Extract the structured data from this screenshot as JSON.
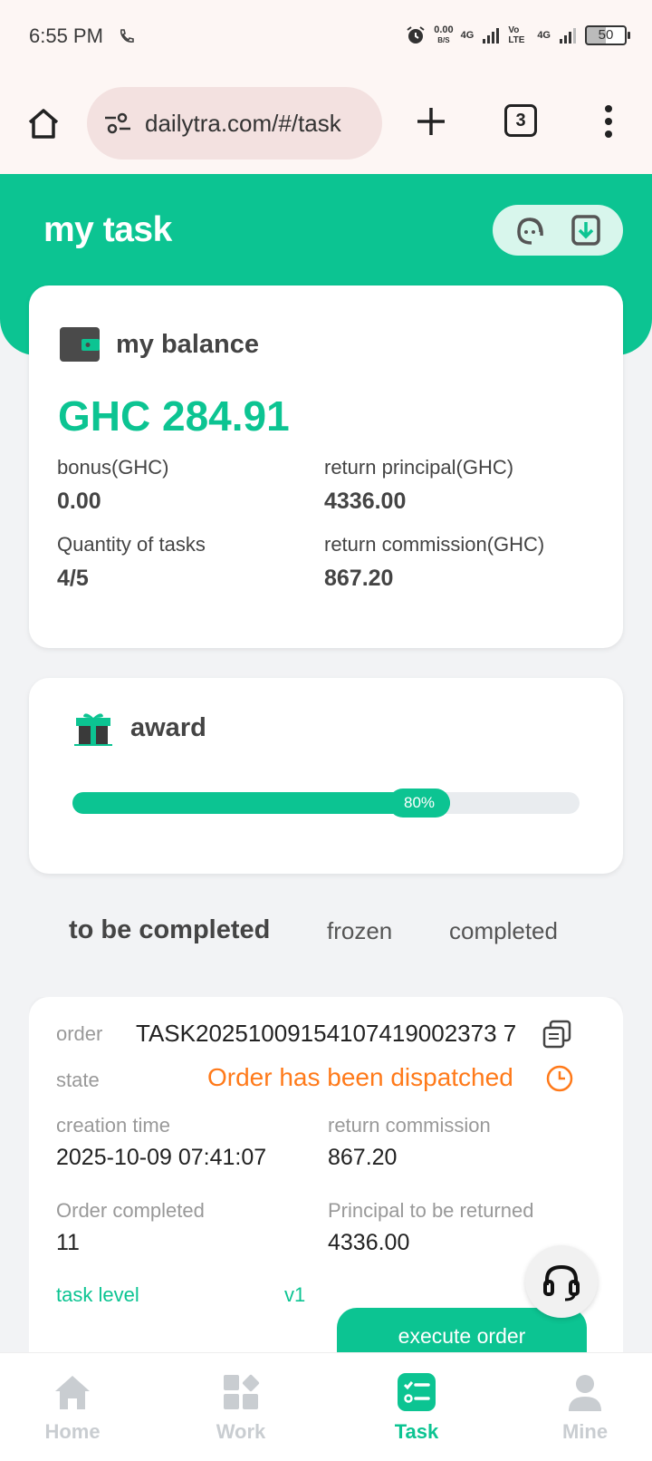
{
  "status_bar": {
    "time": "6:55 PM",
    "speed_value": "0.00",
    "speed_unit": "B/S",
    "net1": "4G",
    "net2": "Vo LTE",
    "net3": "4G",
    "battery": "50"
  },
  "browser": {
    "url": "dailytra.com/#/task",
    "tab_count": "3"
  },
  "header": {
    "title": "my task"
  },
  "balance": {
    "title": "my balance",
    "amount": "GHC 284.91",
    "bonus_label": "bonus(GHC)",
    "bonus_value": "0.00",
    "return_principal_label": "return principal(GHC)",
    "return_principal_value": "4336.00",
    "quantity_label": "Quantity of tasks",
    "quantity_value": "4/5",
    "return_commission_label": "return commission(GHC)",
    "return_commission_value": "867.20"
  },
  "award": {
    "title": "award",
    "progress_label": "80%",
    "progress_fraction": 0.8
  },
  "tabs": [
    "to be completed",
    "frozen",
    "completed"
  ],
  "order": {
    "order_label": "order",
    "order_value": "TASK20251009154107419002373 7",
    "state_label": "state",
    "state_value": "Order has been dispatched",
    "creation_time_label": "creation time",
    "creation_time_value": "2025-10-09 07:41:07",
    "return_commission_label": "return commission",
    "return_commission_value": "867.20",
    "order_completed_label": "Order completed",
    "order_completed_value": "11",
    "principal_label": "Principal to be returned",
    "principal_value": "4336.00",
    "task_level_label": "task level",
    "task_level_value": "v1",
    "execute_button": "execute order"
  },
  "nav": [
    {
      "label": "Home"
    },
    {
      "label": "Work"
    },
    {
      "label": "Task"
    },
    {
      "label": "Mine"
    }
  ],
  "colors": {
    "accent": "#0cc492",
    "state": "#ff7a1a",
    "nav_inactive": "#c9cdd1"
  }
}
